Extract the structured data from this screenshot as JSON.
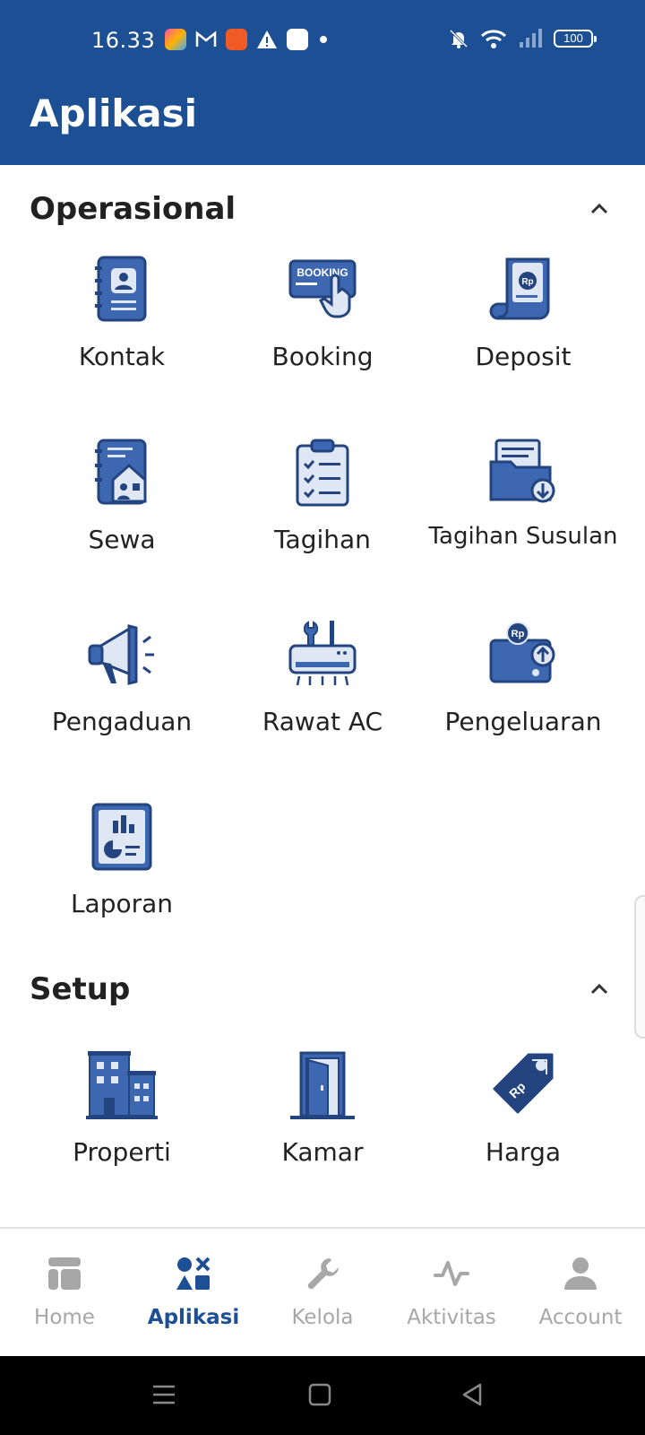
{
  "status_bar": {
    "time": "16.33",
    "battery": "100"
  },
  "app_bar": {
    "title": "Aplikasi"
  },
  "sections": {
    "operasional": {
      "title": "Operasional",
      "items": [
        {
          "label": "Kontak",
          "icon": "contact-book-icon"
        },
        {
          "label": "Booking",
          "icon": "booking-icon"
        },
        {
          "label": "Deposit",
          "icon": "deposit-scroll-icon"
        },
        {
          "label": "Sewa",
          "icon": "rent-house-icon"
        },
        {
          "label": "Tagihan",
          "icon": "clipboard-checklist-icon"
        },
        {
          "label": "Tagihan Susulan",
          "icon": "folder-download-icon"
        },
        {
          "label": "Pengaduan",
          "icon": "megaphone-icon"
        },
        {
          "label": "Rawat AC",
          "icon": "ac-service-icon"
        },
        {
          "label": "Pengeluaran",
          "icon": "wallet-upload-icon"
        },
        {
          "label": "Laporan",
          "icon": "report-chart-icon"
        }
      ]
    },
    "setup": {
      "title": "Setup",
      "items": [
        {
          "label": "Properti",
          "icon": "building-icon"
        },
        {
          "label": "Kamar",
          "icon": "door-icon"
        },
        {
          "label": "Harga",
          "icon": "price-tag-icon"
        }
      ]
    }
  },
  "bottom_nav": {
    "items": [
      {
        "label": "Home",
        "icon": "home-icon"
      },
      {
        "label": "Aplikasi",
        "icon": "apps-icon",
        "active": true
      },
      {
        "label": "Kelola",
        "icon": "wrench-icon"
      },
      {
        "label": "Aktivitas",
        "icon": "activity-icon"
      },
      {
        "label": "Account",
        "icon": "account-icon"
      }
    ]
  },
  "colors": {
    "brand": "#1d4f94",
    "icon_dark": "#23447e",
    "icon_mid": "#3d67b0",
    "icon_light": "#dfe7f5",
    "inactive": "#a7a7a7"
  }
}
